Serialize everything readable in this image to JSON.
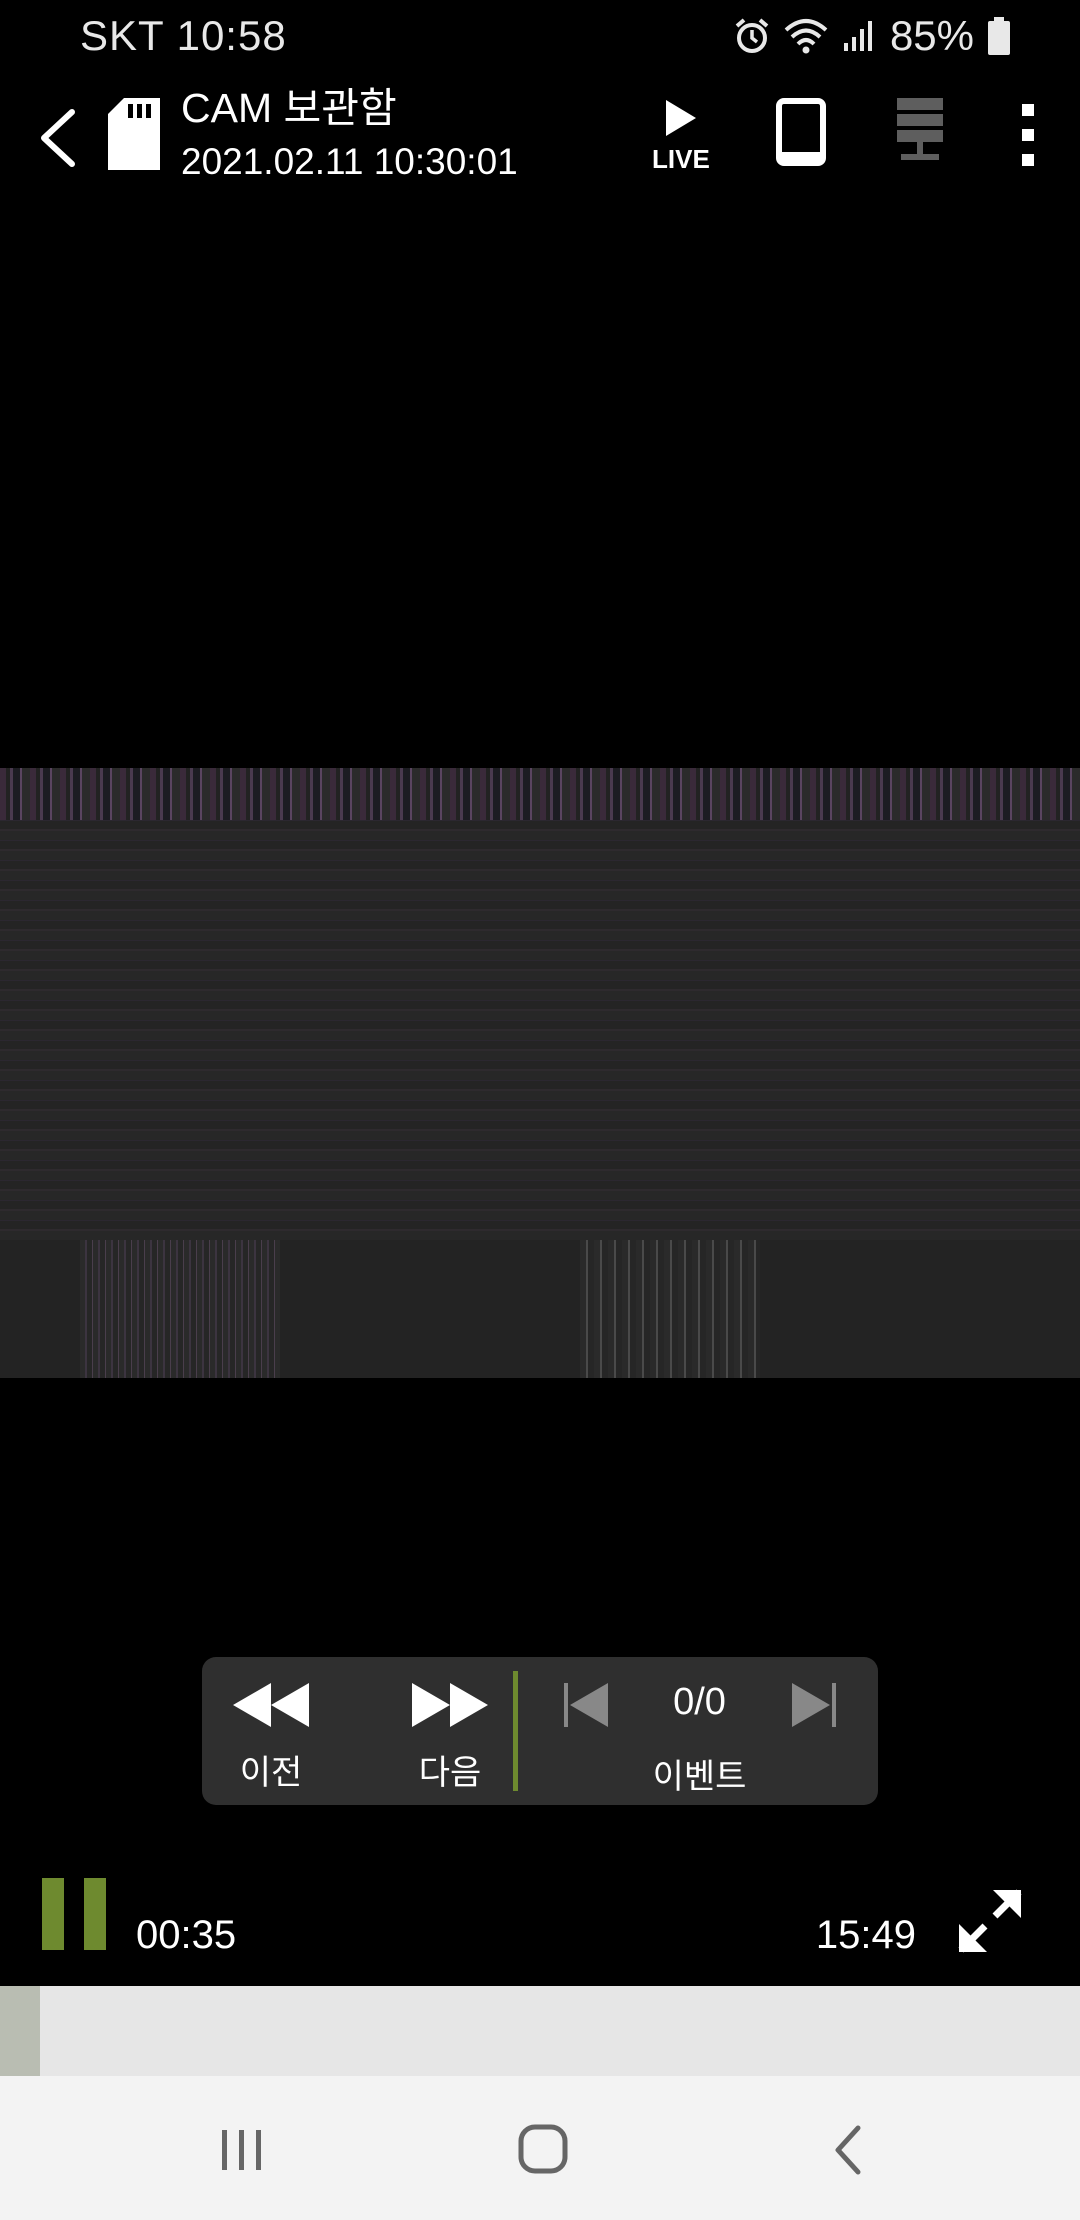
{
  "status_bar": {
    "carrier_time": "SKT 10:58",
    "battery": "85%",
    "icons": [
      "alarm-icon",
      "wifi-icon",
      "signal-icon",
      "battery-icon"
    ]
  },
  "app_bar": {
    "title": "CAM 보관함",
    "timestamp": "2021.02.11 10:30:01",
    "live_label": "LIVE",
    "icons": [
      "back-arrow-icon",
      "sd-card-icon",
      "play-live-icon",
      "phone-icon",
      "server-icon",
      "more-vert-icon"
    ]
  },
  "controls": {
    "prev_label": "이전",
    "next_label": "다음",
    "event_counter": "0/0",
    "event_label": "이벤트",
    "divider_color": "#6e8a2f"
  },
  "playback": {
    "current_time": "00:35",
    "total_time": "15:49",
    "progress_fraction": 0.037,
    "accent_color": "#6e8a2f"
  },
  "nav_bar": {
    "icons": [
      "recents-icon",
      "home-icon",
      "nav-back-icon"
    ]
  }
}
